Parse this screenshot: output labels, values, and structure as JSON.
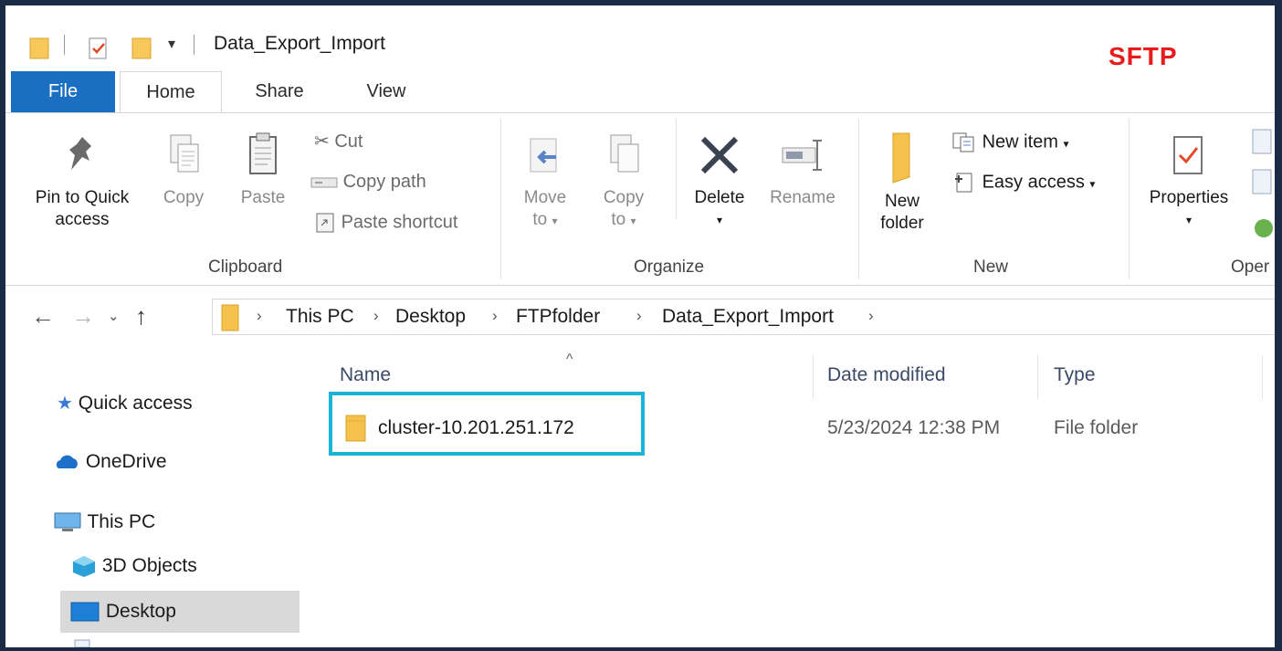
{
  "window": {
    "title": "Data_Export_Import",
    "overlay_label": "SFTP",
    "overlay_color": "#e81c1c"
  },
  "tabs": [
    {
      "label": "File",
      "active": false
    },
    {
      "label": "Home",
      "active": true
    },
    {
      "label": "Share",
      "active": false
    },
    {
      "label": "View",
      "active": false
    }
  ],
  "ribbon": {
    "clipboard": {
      "group_label": "Clipboard",
      "pin_line1": "Pin to Quick",
      "pin_line2": "access",
      "copy": "Copy",
      "paste": "Paste",
      "cut": "Cut",
      "copy_path": "Copy path",
      "paste_shortcut": "Paste shortcut"
    },
    "organize": {
      "group_label": "Organize",
      "move_line1": "Move",
      "move_line2": "to",
      "copy_line1": "Copy",
      "copy_line2": "to",
      "delete": "Delete",
      "rename": "Rename"
    },
    "new": {
      "group_label": "New",
      "new_folder_line1": "New",
      "new_folder_line2": "folder",
      "new_item": "New item",
      "easy_access": "Easy access"
    },
    "open": {
      "group_label": "Oper",
      "properties": "Properties"
    }
  },
  "address": {
    "crumbs": [
      "This PC",
      "Desktop",
      "FTPfolder",
      "Data_Export_Import"
    ]
  },
  "nav_pane": {
    "items": [
      {
        "label": "Quick access",
        "icon": "star-icon"
      },
      {
        "label": "OneDrive",
        "icon": "cloud-icon"
      },
      {
        "label": "This PC",
        "icon": "computer-icon"
      },
      {
        "label": "3D Objects",
        "icon": "cube-icon"
      },
      {
        "label": "Desktop",
        "icon": "desktop-icon",
        "selected": true
      }
    ]
  },
  "content": {
    "columns": {
      "name": "Name",
      "date": "Date modified",
      "type": "Type"
    },
    "rows": [
      {
        "name": "cluster-10.201.251.172",
        "date": "5/23/2024 12:38 PM",
        "type": "File folder"
      }
    ],
    "highlight_color": "#19b4d8"
  }
}
